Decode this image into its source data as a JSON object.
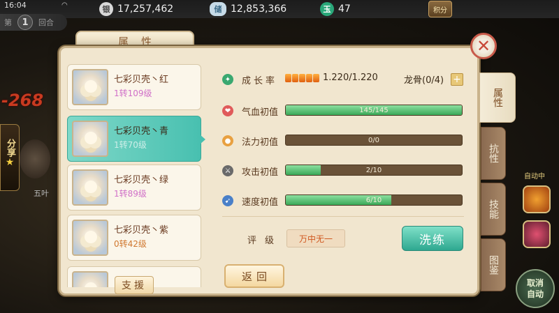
{
  "status": {
    "time": "16:04"
  },
  "resources": [
    {
      "icon": "silver-coin-icon",
      "glyph": "银",
      "value": "17,257,462"
    },
    {
      "icon": "reserve-coin-icon",
      "glyph": "储",
      "value": "12,853,366"
    },
    {
      "icon": "jade-icon",
      "glyph": "玉",
      "value": "47"
    }
  ],
  "score_button": "积分",
  "round": {
    "prefix": "第",
    "number": "1",
    "suffix": "回合"
  },
  "battle": {
    "damage": "-268",
    "share_label": "分享",
    "player_name": "五叶"
  },
  "auto": {
    "label": "自动中",
    "cancel_label_1": "取消",
    "cancel_label_2": "自动"
  },
  "panel": {
    "title": "属性",
    "pets": [
      {
        "name": "七彩贝壳丶红",
        "level": "1转109级",
        "level_color": "pink",
        "selected": false
      },
      {
        "name": "七彩贝壳丶青",
        "level": "1转70级",
        "level_color": "teal",
        "selected": true
      },
      {
        "name": "七彩贝壳丶绿",
        "level": "1转89级",
        "level_color": "pink",
        "selected": false
      },
      {
        "name": "七彩贝壳丶紫",
        "level": "0转42级",
        "level_color": "orange",
        "selected": false
      }
    ],
    "support_button": "支援",
    "growth": {
      "label": "成长率",
      "value": "1.220/1.220",
      "pips": 5
    },
    "dragon_bone": "龙骨(0/4)",
    "stats": [
      {
        "label": "气血初值",
        "icon": "heart-icon",
        "glyph": "❤",
        "color": "#e05a5a",
        "current": 145,
        "max": 145,
        "text": "145/145"
      },
      {
        "label": "法力初值",
        "icon": "mana-icon",
        "glyph": "●",
        "color": "#e8a040",
        "current": 0,
        "max": 0,
        "text": "0/0"
      },
      {
        "label": "攻击初值",
        "icon": "sword-icon",
        "glyph": "⚔",
        "color": "#6a6a6a",
        "current": 2,
        "max": 10,
        "text": "2/10"
      },
      {
        "label": "速度初值",
        "icon": "speed-icon",
        "glyph": "➹",
        "color": "#4a80c8",
        "current": 6,
        "max": 10,
        "text": "6/10"
      }
    ],
    "rating_label": "评级",
    "rating_value": "万中无一",
    "wash_button": "洗练",
    "back_button": "返回",
    "tabs": [
      {
        "label": "属性",
        "active": true
      },
      {
        "label": "抗性",
        "active": false
      },
      {
        "label": "技能",
        "active": false
      },
      {
        "label": "图鉴",
        "active": false
      }
    ]
  }
}
